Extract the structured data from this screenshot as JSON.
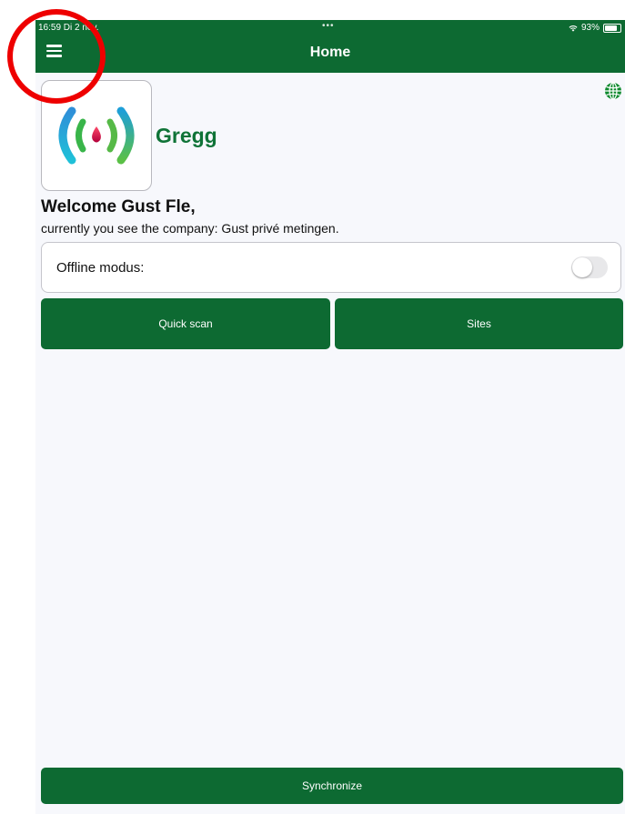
{
  "status_bar": {
    "time": "16:59  Di 2  nov.",
    "dots": "•••",
    "battery_text": "93%",
    "battery_level": 0.93
  },
  "header": {
    "title": "Home"
  },
  "company": {
    "name": "Gregg"
  },
  "welcome": {
    "greeting": "Welcome Gust Fle,",
    "company_line": "currently you see the company: Gust privé metingen."
  },
  "offline": {
    "label": "Offline modus:",
    "enabled": false
  },
  "buttons": {
    "quick_scan": "Quick scan",
    "sites": "Sites",
    "synchronize": "Synchronize"
  },
  "icons": {
    "menu": "hamburger-menu-icon",
    "globe": "globe-icon",
    "wifi": "wifi-icon",
    "battery": "battery-icon",
    "logo": "signal-waves-logo"
  },
  "colors": {
    "primary": "#0d6a32",
    "brand_text": "#0f7337",
    "annotation": "#ee0000"
  }
}
